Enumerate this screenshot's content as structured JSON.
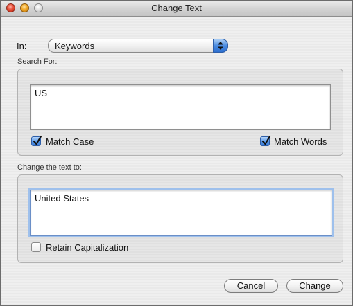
{
  "window": {
    "title": "Change Text"
  },
  "in_row": {
    "label": "In:",
    "selected": "Keywords"
  },
  "search_group": {
    "label": "Search For:",
    "text": "US",
    "match_case": {
      "label": "Match Case",
      "checked": true
    },
    "match_words": {
      "label": "Match Words",
      "checked": true
    }
  },
  "change_group": {
    "label": "Change the text to:",
    "text": "United States",
    "retain_capitalization": {
      "label": "Retain Capitalization",
      "checked": false
    }
  },
  "buttons": {
    "cancel": "Cancel",
    "change": "Change"
  },
  "colors": {
    "checkbox_accent": "#3a7bd6",
    "focus_ring": "#9ec0ec"
  }
}
